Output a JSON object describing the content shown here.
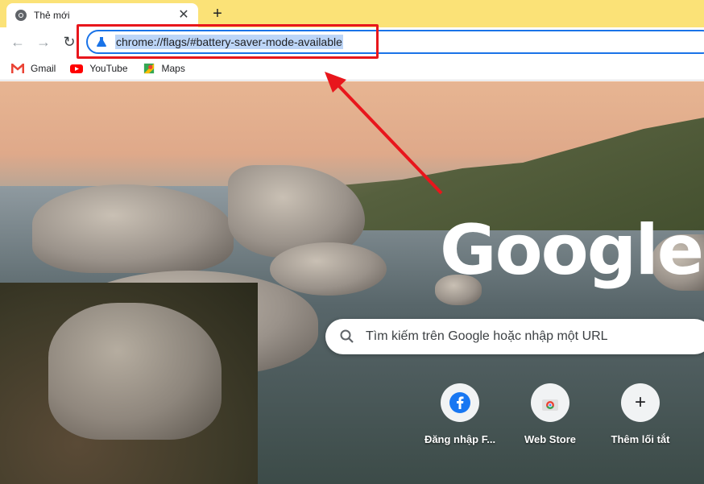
{
  "tab": {
    "title": "Thẻ mới",
    "favicon": "chrome-icon",
    "close_icon": "close-icon"
  },
  "new_tab_icon": "plus-icon",
  "toolbar": {
    "back_icon": "arrow-left-icon",
    "forward_icon": "arrow-right-icon",
    "reload_icon": "reload-icon",
    "url": "chrome://flags/#battery-saver-mode-available",
    "url_icon": "flask-icon"
  },
  "bookmarks": [
    {
      "label": "Gmail",
      "icon": "gmail-icon"
    },
    {
      "label": "YouTube",
      "icon": "youtube-icon"
    },
    {
      "label": "Maps",
      "icon": "maps-icon"
    }
  ],
  "logo": "Google",
  "search": {
    "placeholder": "Tìm kiếm trên Google hoặc nhập một URL",
    "icon": "search-icon"
  },
  "shortcuts": [
    {
      "label": "Đăng nhập F...",
      "icon": "facebook-icon"
    },
    {
      "label": "Web Store",
      "icon": "chrome-web-store-icon"
    },
    {
      "label": "Thêm lối tắt",
      "icon": "plus-icon"
    }
  ],
  "colors": {
    "tabstrip": "#fbe277",
    "annotation": "#e8161c",
    "omnibox_border": "#1a73e8",
    "url_selection": "#bcd5f7"
  }
}
